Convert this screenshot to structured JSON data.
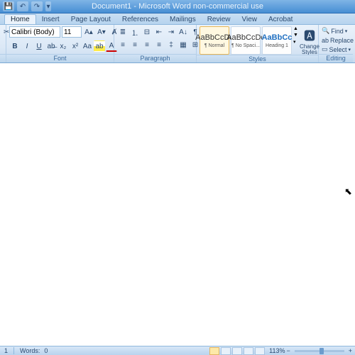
{
  "title": {
    "doc": "Document1",
    "app": "Microsoft Word non-commercial use"
  },
  "tabs": {
    "home": "Home",
    "insert": "Insert",
    "page_layout": "Page Layout",
    "references": "References",
    "mailings": "Mailings",
    "review": "Review",
    "view": "View",
    "acrobat": "Acrobat"
  },
  "font": {
    "family": "Calibri (Body)",
    "size": "11",
    "group_label": "Font"
  },
  "paragraph": {
    "group_label": "Paragraph"
  },
  "styles": {
    "group_label": "Styles",
    "items": [
      {
        "preview": "AaBbCcDc",
        "name": "¶ Normal"
      },
      {
        "preview": "AaBbCcDc",
        "name": "¶ No Spaci..."
      },
      {
        "preview": "AaBbCc",
        "name": "Heading 1"
      }
    ],
    "change": "Change Styles"
  },
  "editing": {
    "group_label": "Editing",
    "find": "Find",
    "replace": "Replace",
    "select": "Select"
  },
  "status": {
    "page": "1",
    "words_label": "Words:",
    "words_val": "0",
    "zoom": "113%"
  }
}
